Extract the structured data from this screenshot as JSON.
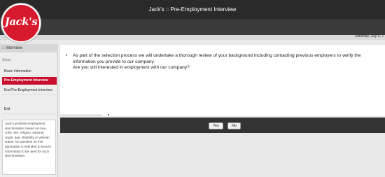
{
  "header": {
    "title": "Jack's :: Pre-Employment Interview",
    "date": "Saturday, July 6, 2"
  },
  "logo": {
    "text": "Jack's",
    "color": "#d7192d"
  },
  "sidebar": {
    "header": ":: Interview",
    "steps_label": "Steps",
    "items": [
      {
        "label": "Basic Information",
        "active": false
      },
      {
        "label": "Pre-Employment Interview",
        "active": true
      },
      {
        "label": "End Pre-Employment Interview",
        "active": false
      },
      {
        "label": "Exit",
        "active": false
      }
    ],
    "notice": "Jack's prohibits employment discrimination based on race, color, sex, religion, national origin, age, disability or veteran status. No question on this application is intended to secure information to be used for such discrimination."
  },
  "content": {
    "paragraph": "As part of the selection process we will undertake a thorough review of your background including contacting previous employers to verify the information you provide to our company.",
    "question": "Are you still interested in employment with our company?"
  },
  "actions": {
    "yes_label": "Yes",
    "no_label": "No"
  },
  "colors": {
    "accent": "#c8102e",
    "topbar": "#2a2a2a",
    "actionbar": "#333333"
  }
}
